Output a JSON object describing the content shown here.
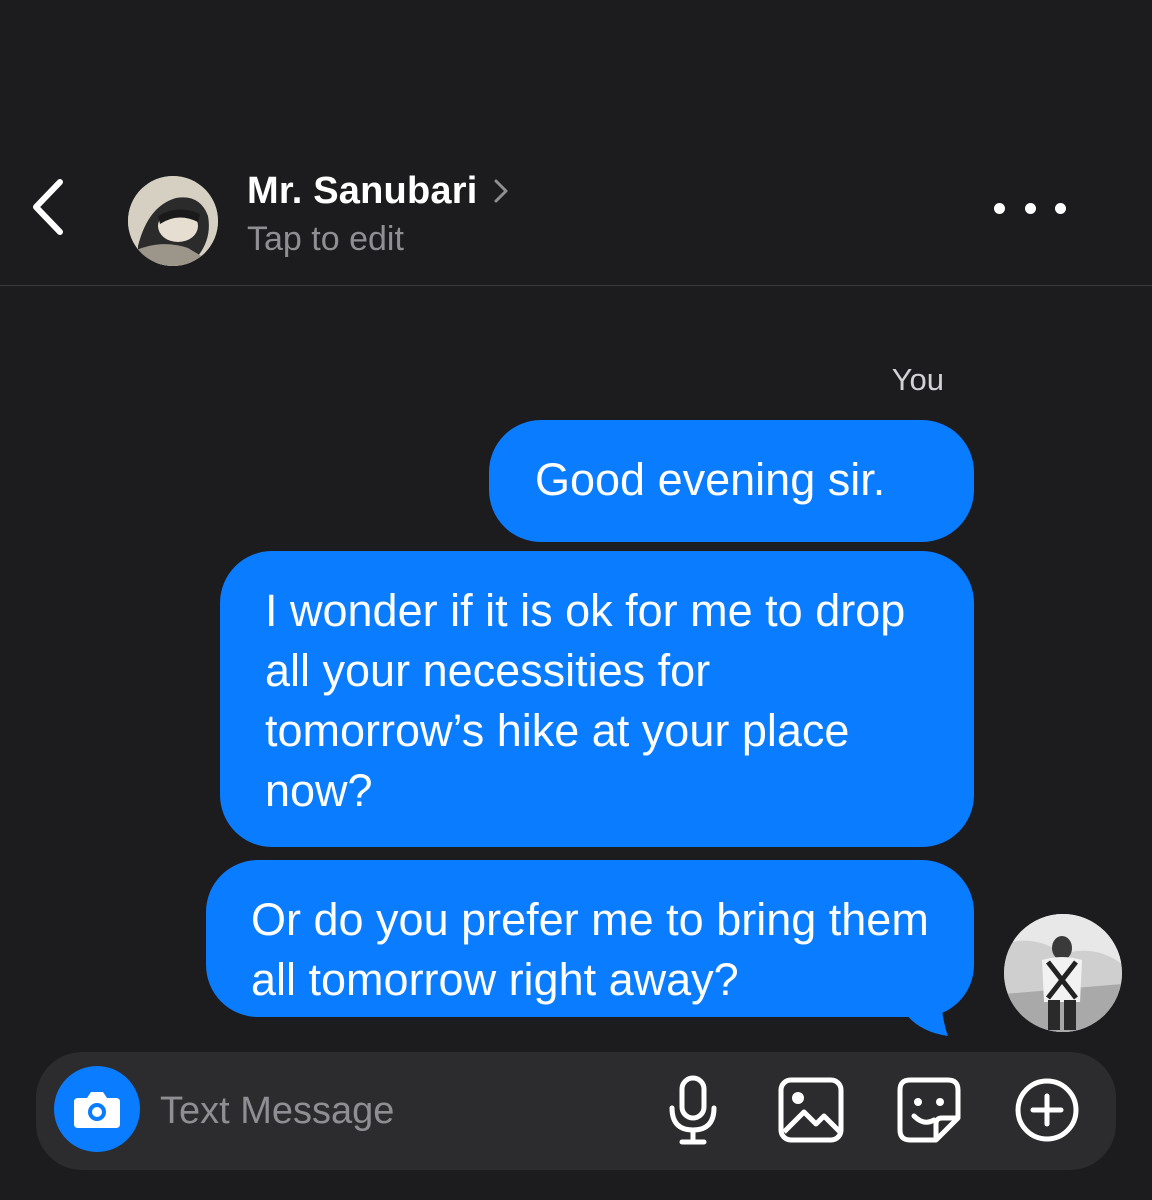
{
  "header": {
    "contact_name": "Mr. Sanubari",
    "subtitle": "Tap to edit"
  },
  "conversation": {
    "sender_label": "You",
    "messages": [
      {
        "text": "Good evening sir."
      },
      {
        "text": "I wonder if it is ok for me to drop all your necessities for tomorrow’s hike at your place now?"
      },
      {
        "text": "Or do you prefer me to bring them all tomorrow right away?"
      }
    ]
  },
  "composer": {
    "placeholder": "Text Message",
    "value": ""
  },
  "colors": {
    "background": "#1c1c1e",
    "bubble": "#0a7cff",
    "input_bar": "#2c2c2e",
    "secondary_text": "#8e8e93"
  },
  "icons": {
    "back": "chevron-left-icon",
    "more": "ellipsis-icon",
    "camera": "camera-icon",
    "mic": "microphone-icon",
    "gallery": "image-icon",
    "sticker": "sticker-icon",
    "add": "plus-circle-icon"
  }
}
